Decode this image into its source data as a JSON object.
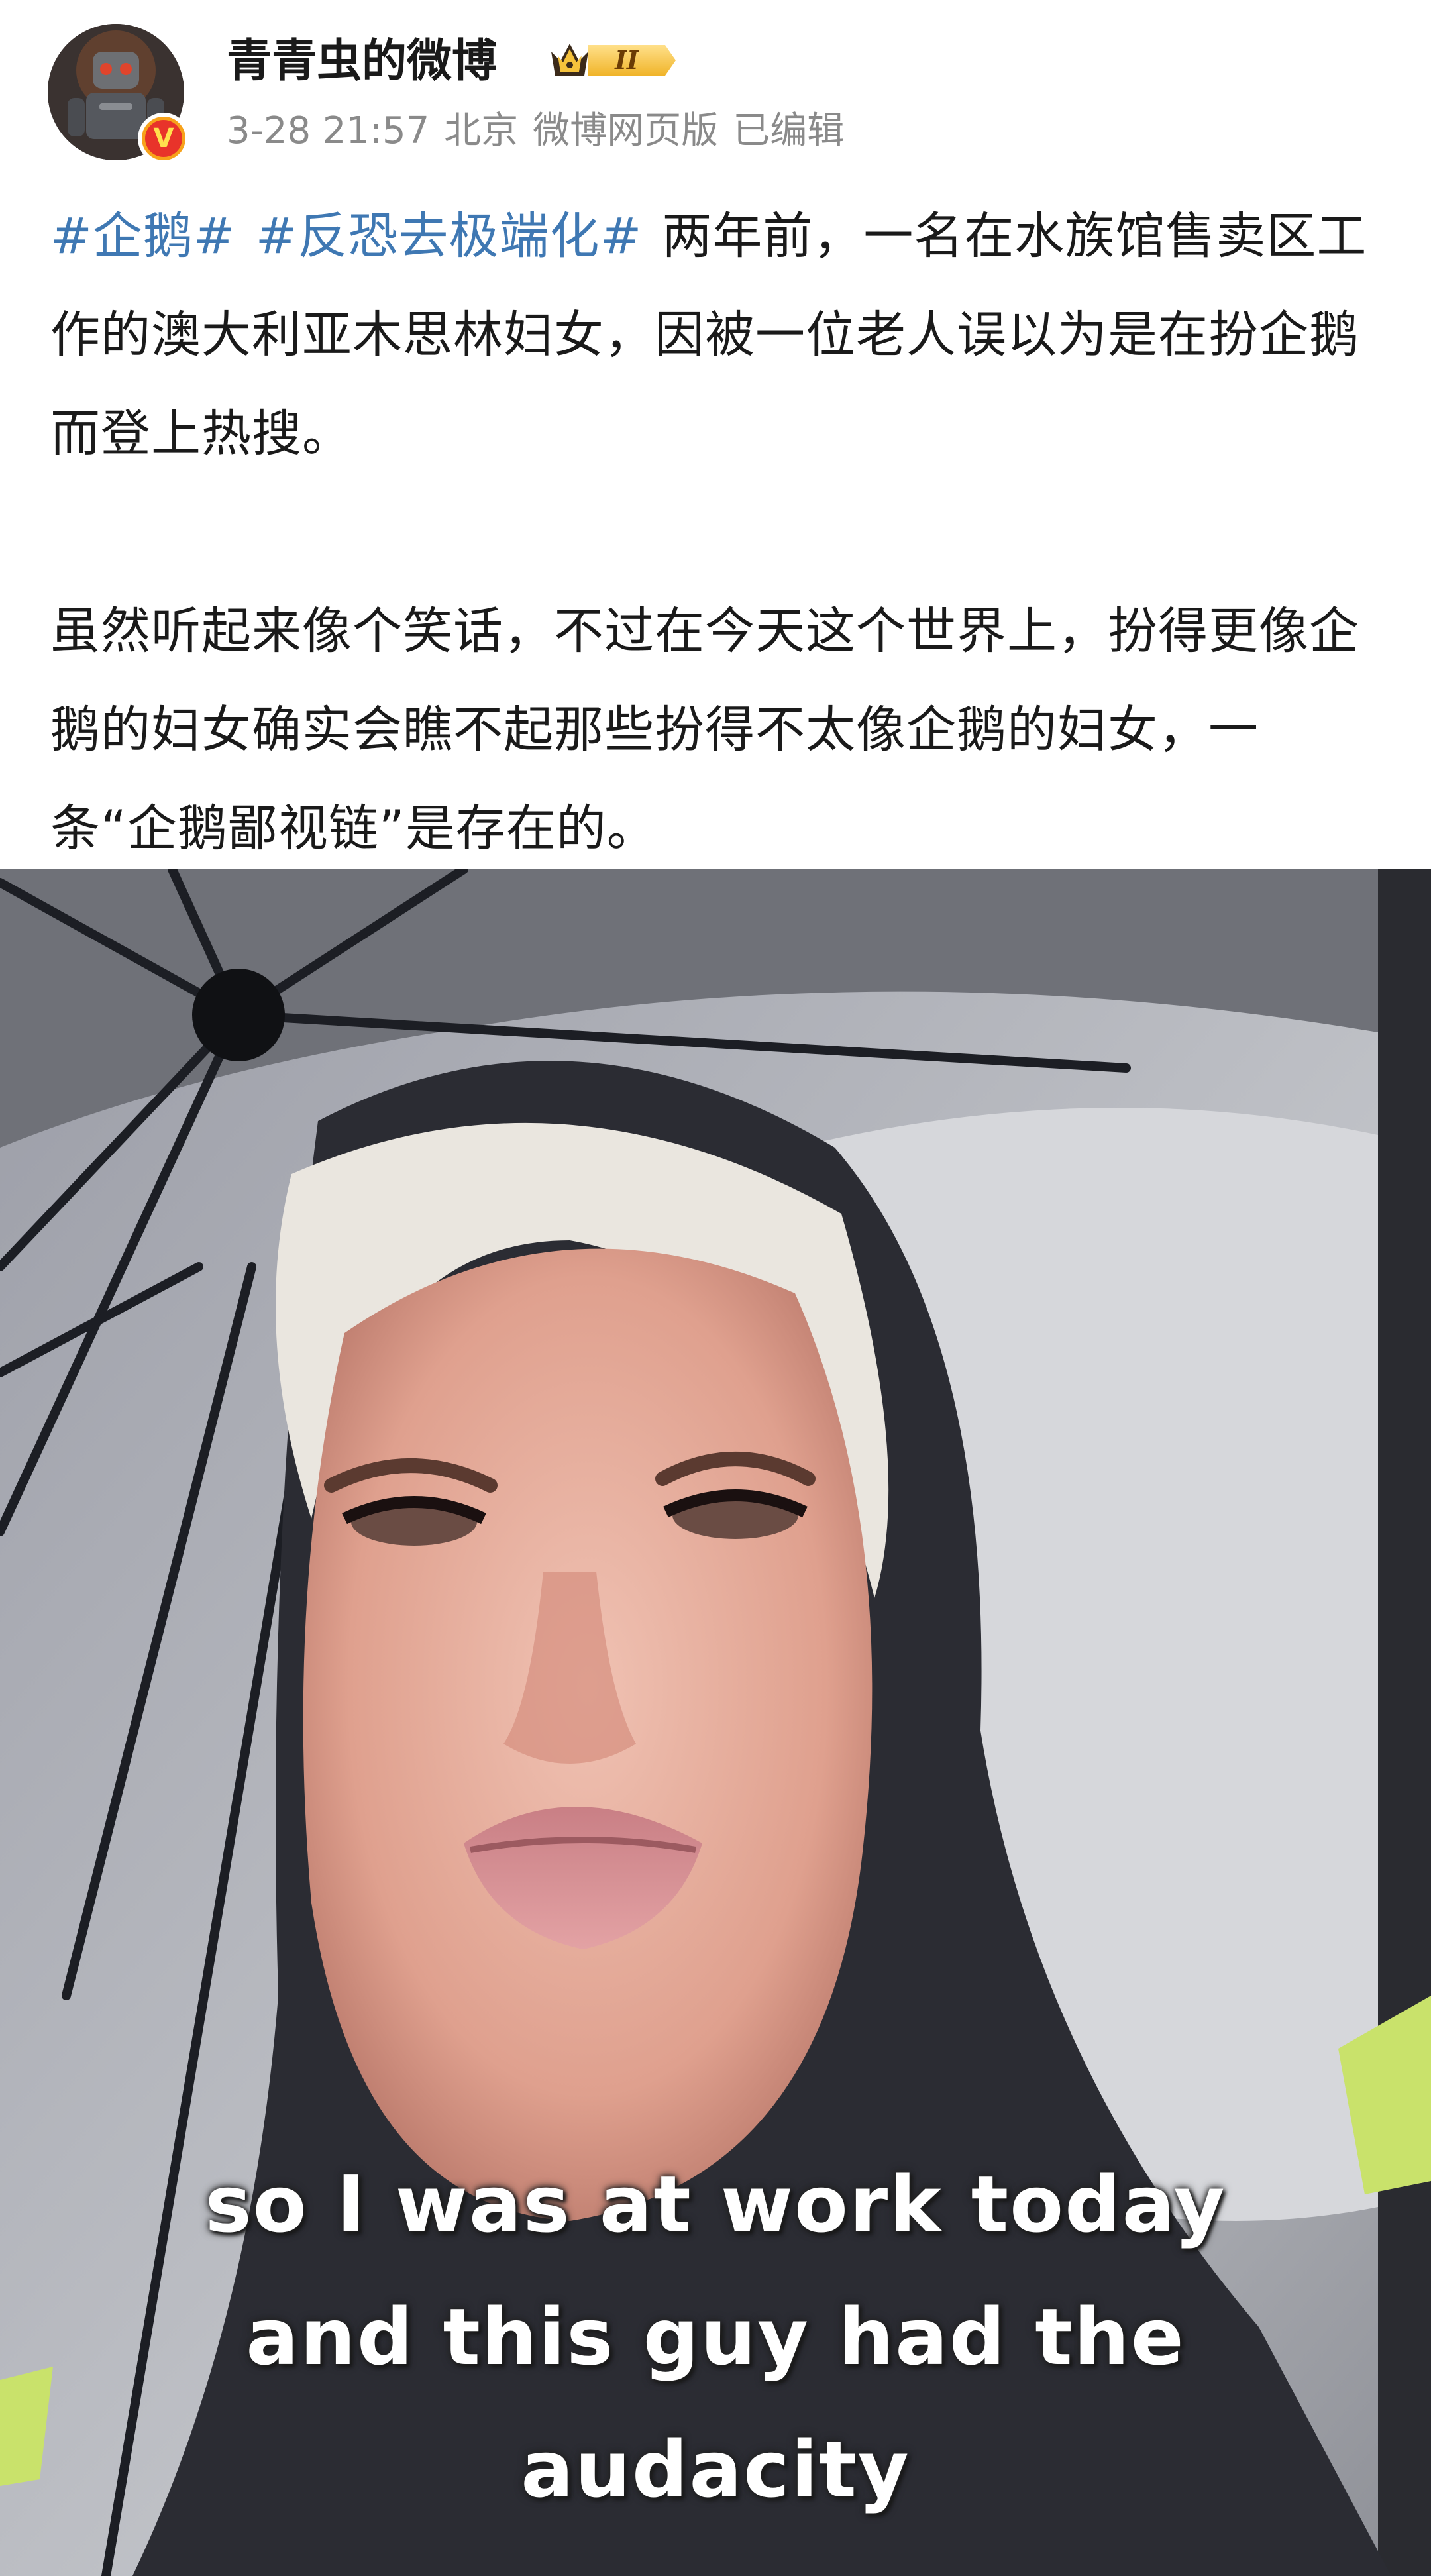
{
  "post": {
    "author": {
      "name": "青青虫的微博",
      "verified_mark": "V",
      "vip_level": "II",
      "avatar_icon": "robot-avatar-icon"
    },
    "meta": {
      "time": "3-28 21:57",
      "location": "北京",
      "source": "微博网页版",
      "edited": "已编辑"
    },
    "hashtags": [
      "#企鹅#",
      "#反恐去极端化#"
    ],
    "paragraph_1": "两年前，一名在水族馆售卖区工作的澳大利亚木思林妇女，因被一位老人误以为是在扮企鹅而登上热搜。",
    "paragraph_2": "虽然听起来像个笑话，不过在今天这个世界上，扮得更像企鹅的妇女确实会瞧不起那些扮得不太像企鹅的妇女，一条“企鹅鄙视链”是存在的。",
    "video": {
      "subtitle_lines": [
        "so I was at work today",
        "and this guy had the",
        "audacity"
      ]
    }
  },
  "colors": {
    "hashtag": "#3f78b3",
    "text": "#1a1a1a",
    "meta": "#8a8a8a",
    "vip_gold": "#f5c23c",
    "verified_orange": "#f7a21b"
  }
}
